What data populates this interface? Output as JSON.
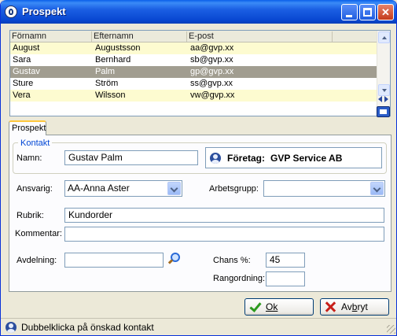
{
  "window": {
    "title": "Prospekt"
  },
  "grid": {
    "columns": [
      "Förnamn",
      "Efternamn",
      "E-post"
    ],
    "rows": [
      {
        "first": "August",
        "last": "Augustsson",
        "email": "aa@gvp.xx"
      },
      {
        "first": "Sara",
        "last": "Bernhard",
        "email": "sb@gvp.xx"
      },
      {
        "first": "Gustav",
        "last": "Palm",
        "email": "gp@gvp.xx"
      },
      {
        "first": "Sture",
        "last": "Ström",
        "email": "ss@gvp.xx"
      },
      {
        "first": "Vera",
        "last": "Wilsson",
        "email": "vw@gvp.xx"
      }
    ],
    "selected_index": 2
  },
  "tab": {
    "label": "Prospekt"
  },
  "kontakt": {
    "legend": "Kontakt",
    "namn_label": "Namn:",
    "namn_value": "Gustav Palm",
    "foretag_label": "Företag:",
    "foretag_value": "GVP Service AB"
  },
  "form": {
    "ansvarig_label": "Ansvarig:",
    "ansvarig_value": "AA-Anna Aster",
    "arbetsgrupp_label": "Arbetsgrupp:",
    "arbetsgrupp_value": "",
    "rubrik_label": "Rubrik:",
    "rubrik_value": "Kundorder",
    "kommentar_label": "Kommentar:",
    "kommentar_value": "",
    "avdelning_label": "Avdelning:",
    "avdelning_value": "",
    "chans_label": "Chans %:",
    "chans_value": "45",
    "rangordning_label": "Rangordning:",
    "rangordning_value": ""
  },
  "buttons": {
    "ok_label": "Ok",
    "cancel_label_pre": "Av",
    "cancel_label_u": "b",
    "cancel_label_post": "ryt"
  },
  "status": {
    "text": "Dubbelklicka på önskad kontakt"
  },
  "colors": {
    "title_bar": "#0a4fd6",
    "row_highlight": "#fdfbd0",
    "row_selected": "#a19d90",
    "legend": "#0046d5"
  }
}
